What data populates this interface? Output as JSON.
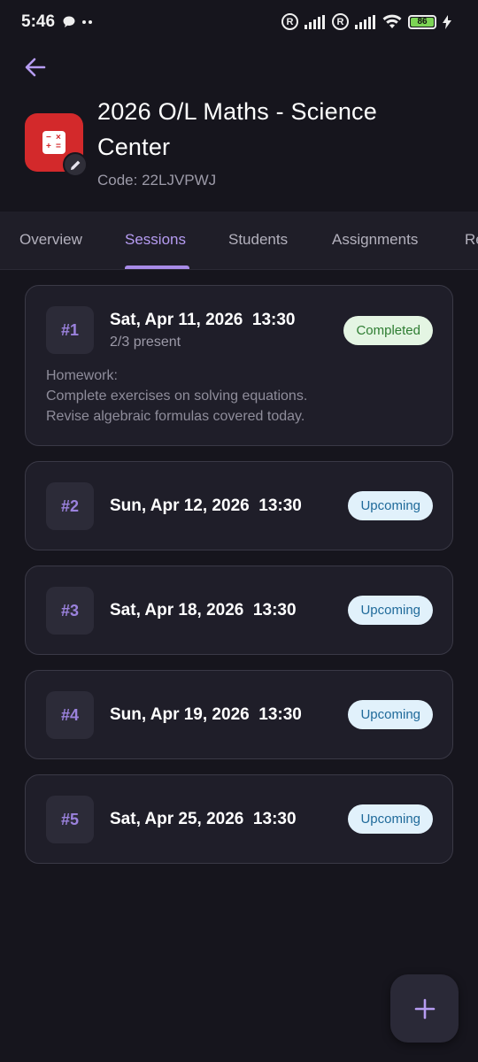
{
  "status_bar": {
    "time": "5:46",
    "battery": "86"
  },
  "header": {
    "title": "2026 O/L Maths - Science Center",
    "code": "Code: 22LJVPWJ"
  },
  "tabs": [
    {
      "label": "Overview"
    },
    {
      "label": "Sessions",
      "active": true
    },
    {
      "label": "Students"
    },
    {
      "label": "Assignments"
    },
    {
      "label": "Re"
    }
  ],
  "sessions": [
    {
      "number": "#1",
      "date": "Sat, Apr 11, 2026  13:30",
      "attendance": "2/3 present",
      "status": "Completed",
      "homework": [
        "Homework:",
        "Complete exercises on solving equations.",
        "Revise algebraic formulas covered today."
      ]
    },
    {
      "number": "#2",
      "date": "Sun, Apr 12, 2026  13:30",
      "status": "Upcoming"
    },
    {
      "number": "#3",
      "date": "Sat, Apr 18, 2026  13:30",
      "status": "Upcoming"
    },
    {
      "number": "#4",
      "date": "Sun, Apr 19, 2026  13:30",
      "status": "Upcoming"
    },
    {
      "number": "#5",
      "date": "Sat, Apr 25, 2026  13:30",
      "status": "Upcoming"
    }
  ],
  "colors": {
    "accent": "#a88be8",
    "background": "#16151d",
    "card": "#1f1e29",
    "icon_red": "#d3292b"
  }
}
